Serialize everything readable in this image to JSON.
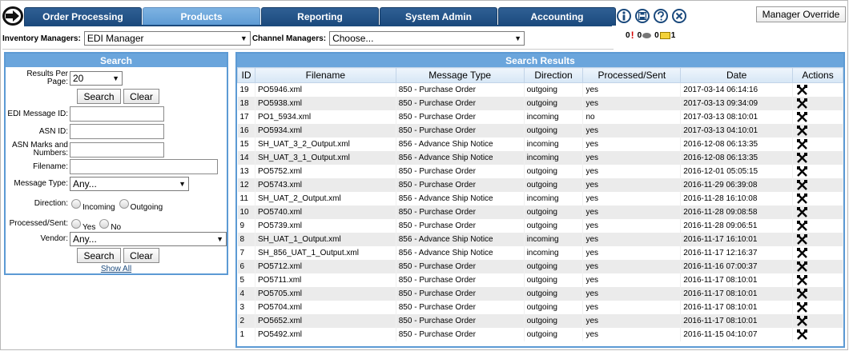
{
  "nav": {
    "tabs": [
      {
        "label": "Order Processing",
        "active": false
      },
      {
        "label": "Products",
        "active": true
      },
      {
        "label": "Reporting",
        "active": false
      },
      {
        "label": "System Admin",
        "active": false
      },
      {
        "label": "Accounting",
        "active": false
      }
    ],
    "icons": [
      "info-icon",
      "save-icon",
      "help-icon",
      "close-icon"
    ],
    "manager_override_label": "Manager Override",
    "notifications": {
      "alerts": "0",
      "messages": "0",
      "mail_prefix": "0",
      "mail": "1"
    }
  },
  "managers": {
    "inventory_label": "Inventory Managers:",
    "inventory_value": "EDI Manager",
    "channel_label": "Channel Managers:",
    "channel_value": "Choose..."
  },
  "search": {
    "title": "Search",
    "results_per_page_label": "Results Per Page:",
    "results_per_page_value": "20",
    "search_button": "Search",
    "clear_button": "Clear",
    "edi_message_id_label": "EDI Message ID:",
    "asn_id_label": "ASN ID:",
    "asn_marks_label": "ASN Marks and Numbers:",
    "filename_label": "Filename:",
    "message_type_label": "Message Type:",
    "message_type_value": "Any...",
    "direction_label": "Direction:",
    "direction_incoming": "Incoming",
    "direction_outgoing": "Outgoing",
    "processed_label": "Processed/Sent:",
    "processed_yes": "Yes",
    "processed_no": "No",
    "vendor_label": "Vendor:",
    "vendor_value": "Any...",
    "show_all": "Show All"
  },
  "results": {
    "title": "Search Results",
    "columns": [
      "ID",
      "Filename",
      "Message Type",
      "Direction",
      "Processed/Sent",
      "Date",
      "Actions"
    ],
    "rows": [
      {
        "id": "19",
        "filename": "PO5946.xml",
        "type": "850 - Purchase Order",
        "direction": "outgoing",
        "processed": "yes",
        "date": "2017-03-14 06:14:16"
      },
      {
        "id": "18",
        "filename": "PO5938.xml",
        "type": "850 - Purchase Order",
        "direction": "outgoing",
        "processed": "yes",
        "date": "2017-03-13 09:34:09"
      },
      {
        "id": "17",
        "filename": "PO1_5934.xml",
        "type": "850 - Purchase Order",
        "direction": "incoming",
        "processed": "no",
        "date": "2017-03-13 08:10:01"
      },
      {
        "id": "16",
        "filename": "PO5934.xml",
        "type": "850 - Purchase Order",
        "direction": "outgoing",
        "processed": "yes",
        "date": "2017-03-13 04:10:01"
      },
      {
        "id": "15",
        "filename": "SH_UAT_3_2_Output.xml",
        "type": "856 - Advance Ship Notice",
        "direction": "incoming",
        "processed": "yes",
        "date": "2016-12-08 06:13:35"
      },
      {
        "id": "14",
        "filename": "SH_UAT_3_1_Output.xml",
        "type": "856 - Advance Ship Notice",
        "direction": "incoming",
        "processed": "yes",
        "date": "2016-12-08 06:13:35"
      },
      {
        "id": "13",
        "filename": "PO5752.xml",
        "type": "850 - Purchase Order",
        "direction": "outgoing",
        "processed": "yes",
        "date": "2016-12-01 05:05:15"
      },
      {
        "id": "12",
        "filename": "PO5743.xml",
        "type": "850 - Purchase Order",
        "direction": "outgoing",
        "processed": "yes",
        "date": "2016-11-29 06:39:08"
      },
      {
        "id": "11",
        "filename": "SH_UAT_2_Output.xml",
        "type": "856 - Advance Ship Notice",
        "direction": "incoming",
        "processed": "yes",
        "date": "2016-11-28 16:10:08"
      },
      {
        "id": "10",
        "filename": "PO5740.xml",
        "type": "850 - Purchase Order",
        "direction": "outgoing",
        "processed": "yes",
        "date": "2016-11-28 09:08:58"
      },
      {
        "id": "9",
        "filename": "PO5739.xml",
        "type": "850 - Purchase Order",
        "direction": "outgoing",
        "processed": "yes",
        "date": "2016-11-28 09:06:51"
      },
      {
        "id": "8",
        "filename": "SH_UAT_1_Output.xml",
        "type": "856 - Advance Ship Notice",
        "direction": "incoming",
        "processed": "yes",
        "date": "2016-11-17 16:10:01"
      },
      {
        "id": "7",
        "filename": "SH_856_UAT_1_Output.xml",
        "type": "856 - Advance Ship Notice",
        "direction": "incoming",
        "processed": "yes",
        "date": "2016-11-17 12:16:37"
      },
      {
        "id": "6",
        "filename": "PO5712.xml",
        "type": "850 - Purchase Order",
        "direction": "outgoing",
        "processed": "yes",
        "date": "2016-11-16 07:00:37"
      },
      {
        "id": "5",
        "filename": "PO5711.xml",
        "type": "850 - Purchase Order",
        "direction": "outgoing",
        "processed": "yes",
        "date": "2016-11-17 08:10:01"
      },
      {
        "id": "4",
        "filename": "PO5705.xml",
        "type": "850 - Purchase Order",
        "direction": "outgoing",
        "processed": "yes",
        "date": "2016-11-17 08:10:01"
      },
      {
        "id": "3",
        "filename": "PO5704.xml",
        "type": "850 - Purchase Order",
        "direction": "outgoing",
        "processed": "yes",
        "date": "2016-11-17 08:10:01"
      },
      {
        "id": "2",
        "filename": "PO5652.xml",
        "type": "850 - Purchase Order",
        "direction": "outgoing",
        "processed": "yes",
        "date": "2016-11-17 08:10:01"
      },
      {
        "id": "1",
        "filename": "PO5492.xml",
        "type": "850 - Purchase Order",
        "direction": "outgoing",
        "processed": "yes",
        "date": "2016-11-15 04:10:07"
      }
    ]
  }
}
